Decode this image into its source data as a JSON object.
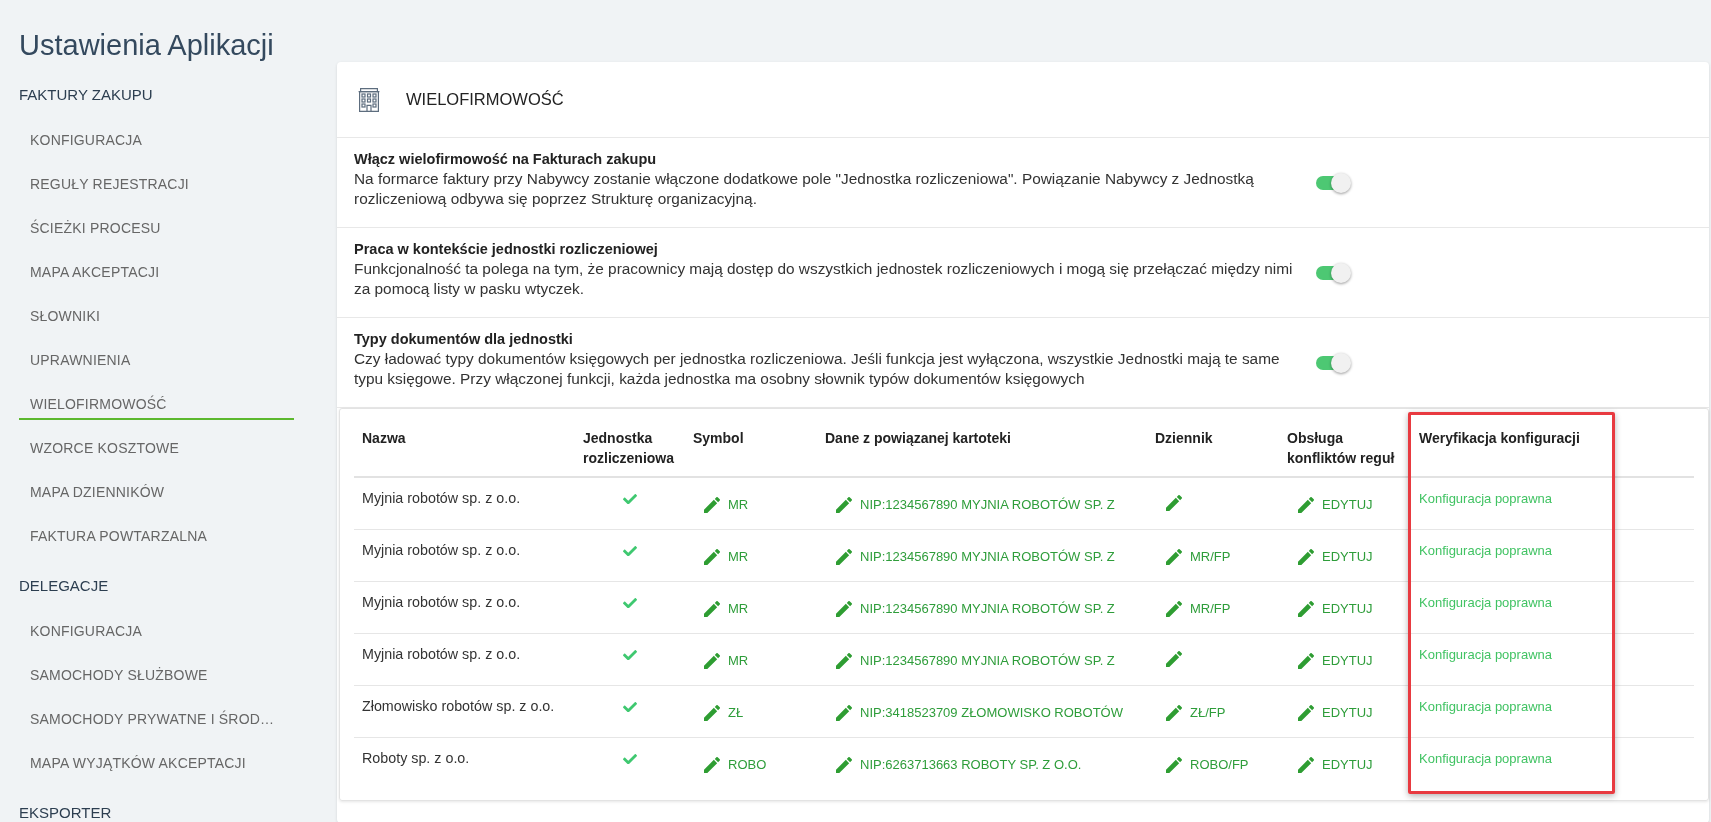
{
  "page": {
    "title": "Ustawienia Aplikacji"
  },
  "sidebar": {
    "sections": [
      {
        "label": "FAKTURY ZAKUPU",
        "items": [
          {
            "label": "KONFIGURACJA",
            "selected": false
          },
          {
            "label": "REGUŁY REJESTRACJI",
            "selected": false
          },
          {
            "label": "ŚCIEŻKI PROCESU",
            "selected": false
          },
          {
            "label": "MAPA AKCEPTACJI",
            "selected": false
          },
          {
            "label": "SŁOWNIKI",
            "selected": false
          },
          {
            "label": "UPRAWNIENIA",
            "selected": false
          },
          {
            "label": "WIELOFIRMOWOŚĆ",
            "selected": true
          },
          {
            "label": "WZORCE KOSZTOWE",
            "selected": false
          },
          {
            "label": "MAPA DZIENNIKÓW",
            "selected": false
          },
          {
            "label": "FAKTURA POWTARZALNA",
            "selected": false
          }
        ]
      },
      {
        "label": "DELEGACJE",
        "items": [
          {
            "label": "KONFIGURACJA",
            "selected": false
          },
          {
            "label": "SAMOCHODY SŁUŻBOWE",
            "selected": false
          },
          {
            "label": "SAMOCHODY PRYWATNE I ŚROD…",
            "selected": false
          },
          {
            "label": "MAPA WYJĄTKÓW AKCEPTACJI",
            "selected": false
          }
        ]
      },
      {
        "label": "EKSPORTER"
      }
    ]
  },
  "panel": {
    "title": "WIELOFIRMOWOŚĆ",
    "settings": [
      {
        "title": "Włącz wielofirmowość na Fakturach zakupu",
        "description": "Na formarce faktury przy Nabywcy zostanie włączone dodatkowe pole \"Jednostka rozliczeniowa\". Powiązanie Nabywcy z Jednostką rozliczeniową odbywa się poprzez Strukturę organizacyjną.",
        "on": true
      },
      {
        "title": "Praca w kontekście jednostki rozliczeniowej",
        "description": "Funkcjonalność ta polega na tym, że pracownicy mają dostęp do wszystkich jednostek rozliczeniowych i mogą się przełączać między nimi za pomocą listy w pasku wtyczek.",
        "on": true
      },
      {
        "title": "Typy dokumentów dla jednostki",
        "description": "Czy ładować typy dokumentów księgowych per jednostka rozliczeniowa. Jeśli funkcja jest wyłączona, wszystkie Jednostki mają te same typu księgowe. Przy włączonej funkcji, każda jednostka ma osobny słownik typów dokumentów księgowych",
        "on": true
      }
    ],
    "table": {
      "columns": [
        {
          "label": "Nazwa",
          "highlighted": false
        },
        {
          "label": "Jednostka rozliczeniowa",
          "highlighted": false
        },
        {
          "label": "Symbol",
          "highlighted": false
        },
        {
          "label": "Dane z powiązanej kartoteki",
          "highlighted": false
        },
        {
          "label": "Dziennik",
          "highlighted": false
        },
        {
          "label": "Obsługa konfliktów reguł",
          "highlighted": false
        },
        {
          "label": "Weryfikacja konfiguracji",
          "highlighted": true
        }
      ],
      "rows": [
        {
          "name": "Myjnia robotów sp. z o.o.",
          "unit_checked": true,
          "symbol": "MR",
          "card": "NIP:1234567890 MYJNIA ROBOTÓW SP. Z",
          "rules": "EDYTUJ",
          "verification": "Konfiguracja poprawna"
        },
        {
          "name": "Myjnia robotów sp. z o.o.",
          "unit_checked": true,
          "symbol": "MR",
          "card": "NIP:1234567890 MYJNIA ROBOTÓW SP. Z",
          "journal": "MR/FP",
          "rules": "EDYTUJ",
          "verification": "Konfiguracja poprawna"
        },
        {
          "name": "Myjnia robotów sp. z o.o.",
          "unit_checked": true,
          "symbol": "MR",
          "card": "NIP:1234567890 MYJNIA ROBOTÓW SP. Z",
          "journal": "MR/FP",
          "rules": "EDYTUJ",
          "verification": "Konfiguracja poprawna"
        },
        {
          "name": "Myjnia robotów sp. z o.o.",
          "unit_checked": true,
          "symbol": "MR",
          "card": "NIP:1234567890 MYJNIA ROBOTÓW SP. Z",
          "rules": "EDYTUJ",
          "verification": "Konfiguracja poprawna"
        },
        {
          "name": "Złomowisko robotów sp. z o.o.",
          "unit_checked": true,
          "symbol": "ZŁ",
          "card": "NIP:3418523709 ZŁOMOWISKO ROBOTÓW",
          "journal": "ZŁ/FP",
          "rules": "EDYTUJ",
          "verification": "Konfiguracja poprawna"
        },
        {
          "name": "Roboty sp. z o.o.",
          "unit_checked": true,
          "symbol": "ROBO",
          "card": "NIP:6263713663 ROBOTY SP. Z O.O.",
          "journal": "ROBO/FP",
          "rules": "EDYTUJ",
          "verification": "Konfiguracja poprawna"
        }
      ]
    }
  }
}
